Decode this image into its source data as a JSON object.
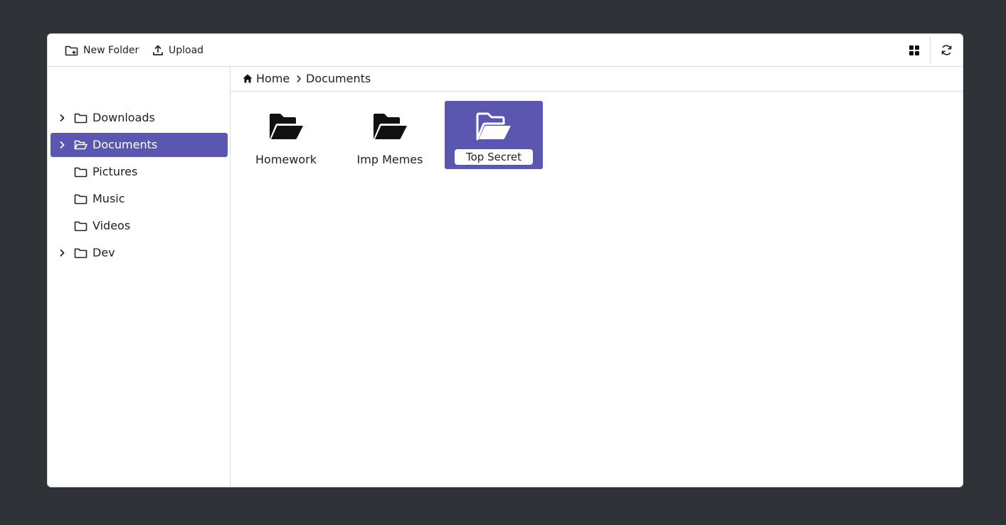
{
  "toolbar": {
    "new_folder_label": "New Folder",
    "upload_label": "Upload",
    "icons": [
      "new-folder-icon",
      "upload-icon",
      "grid-view-icon",
      "refresh-icon"
    ]
  },
  "sidebar": {
    "items": [
      {
        "label": "Downloads",
        "expandable": true,
        "selected": false,
        "icon": "folder-icon"
      },
      {
        "label": "Documents",
        "expandable": true,
        "selected": true,
        "icon": "folder-open-icon"
      },
      {
        "label": "Pictures",
        "expandable": false,
        "selected": false,
        "icon": "folder-icon"
      },
      {
        "label": "Music",
        "expandable": false,
        "selected": false,
        "icon": "folder-icon"
      },
      {
        "label": "Videos",
        "expandable": false,
        "selected": false,
        "icon": "folder-icon"
      },
      {
        "label": "Dev",
        "expandable": true,
        "selected": false,
        "icon": "folder-icon"
      }
    ]
  },
  "breadcrumb": {
    "home_label": "Home",
    "current_label": "Documents"
  },
  "main": {
    "items": [
      {
        "label": "Homework",
        "selected": false
      },
      {
        "label": "Imp Memes",
        "selected": false
      },
      {
        "label": "",
        "selected": true,
        "renaming": true,
        "rename_value": "Top Secret"
      }
    ]
  },
  "colors": {
    "accent": "#5b57b0",
    "background": "#2f3338",
    "panel": "#ffffff",
    "border": "#d9d9d9"
  }
}
